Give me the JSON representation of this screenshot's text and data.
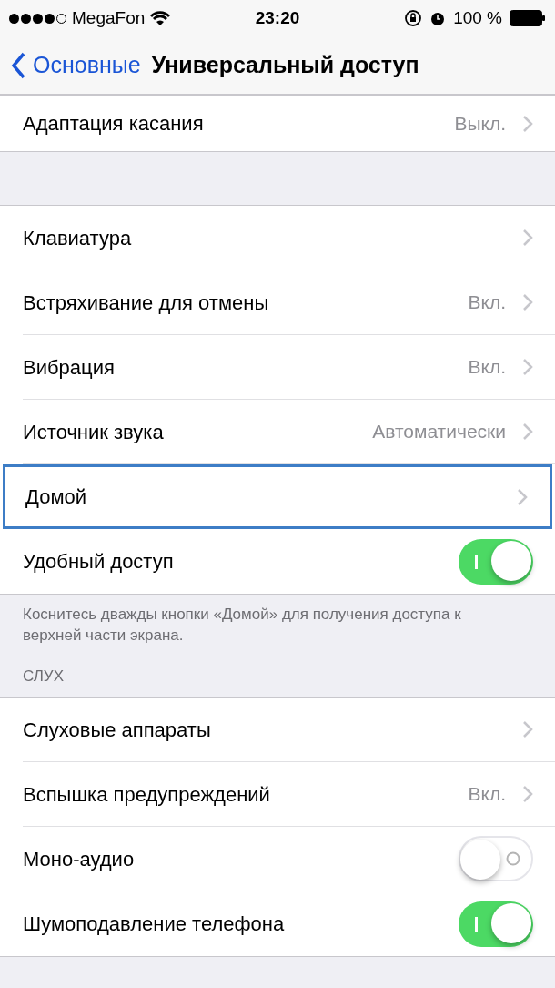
{
  "status_bar": {
    "carrier": "MegaFon",
    "time": "23:20",
    "battery": "100 %"
  },
  "nav": {
    "back": "Основные",
    "title": "Универсальный доступ"
  },
  "sections": [
    {
      "rows": [
        {
          "kind": "chevron",
          "label": "Адаптация касания",
          "value": "Выкл.",
          "highlighted": false
        }
      ]
    },
    {
      "rows": [
        {
          "kind": "chevron",
          "label": "Клавиатура",
          "highlighted": false
        },
        {
          "kind": "chevron",
          "label": "Встряхивание для отмены",
          "value": "Вкл.",
          "highlighted": false
        },
        {
          "kind": "chevron",
          "label": "Вибрация",
          "value": "Вкл.",
          "highlighted": false
        },
        {
          "kind": "chevron",
          "label": "Источник звука",
          "value": "Автоматически",
          "highlighted": false
        },
        {
          "kind": "chevron",
          "label": "Домой",
          "highlighted": true
        },
        {
          "kind": "switch",
          "label": "Удобный доступ",
          "on": true
        }
      ],
      "footer": "Коснитесь дважды кнопки «Домой» для получения доступа к верхней части экрана."
    },
    {
      "header": "СЛУХ",
      "rows": [
        {
          "kind": "chevron",
          "label": "Слуховые аппараты",
          "highlighted": false
        },
        {
          "kind": "chevron",
          "label": "Вспышка предупреждений",
          "value": "Вкл.",
          "highlighted": false
        },
        {
          "kind": "switch",
          "label": "Моно-аудио",
          "on": false
        },
        {
          "kind": "switch",
          "label": "Шумоподавление телефона",
          "on": true
        }
      ]
    }
  ]
}
